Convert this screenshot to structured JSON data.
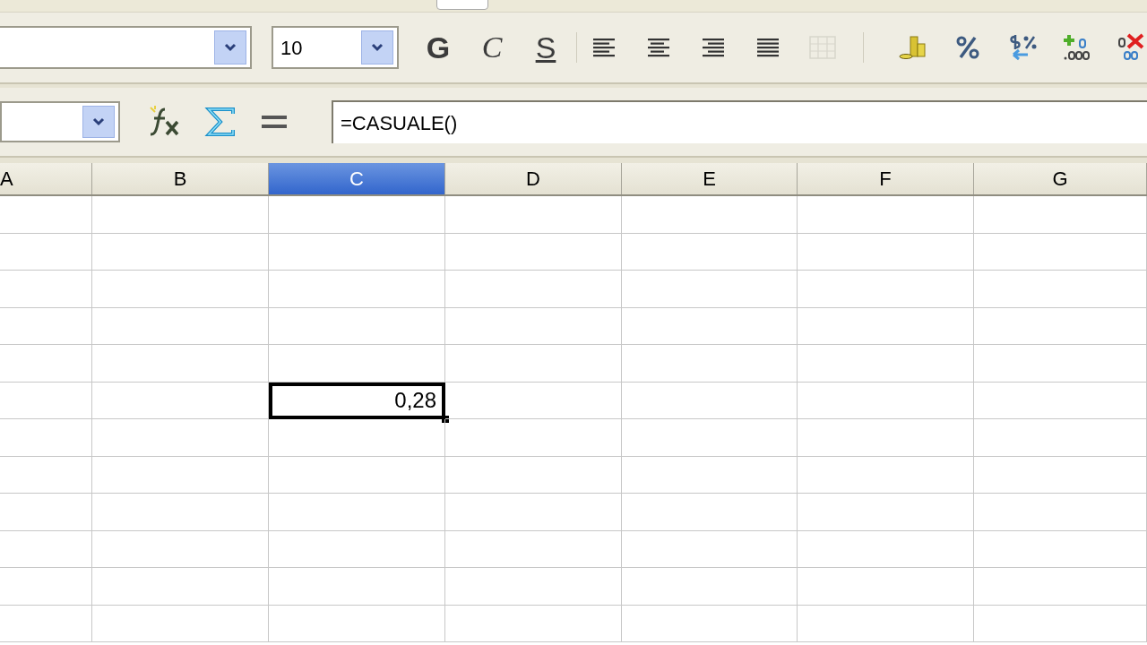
{
  "formatting_toolbar": {
    "font_size": {
      "value": "10"
    },
    "style_buttons": [
      {
        "label": "G",
        "kind": "bold"
      },
      {
        "label": "C",
        "kind": "italic"
      },
      {
        "label": "S",
        "kind": "underline"
      }
    ],
    "tools": [
      {
        "kind": "align-left",
        "disabled": false
      },
      {
        "kind": "align-center",
        "disabled": false
      },
      {
        "kind": "align-right",
        "disabled": false
      },
      {
        "kind": "justify",
        "disabled": false
      },
      {
        "kind": "merge",
        "disabled": true
      },
      {
        "kind": "currency",
        "disabled": false
      },
      {
        "kind": "percent",
        "disabled": false
      },
      {
        "kind": "standard",
        "disabled": false
      },
      {
        "kind": "add-decimal",
        "disabled": false
      },
      {
        "kind": "delete-decimal",
        "disabled": false
      }
    ]
  },
  "formula_bar": {
    "formula": {
      "value": "=CASUALE()"
    }
  },
  "columns": [
    {
      "label": "A",
      "selected": false
    },
    {
      "label": "B",
      "selected": false
    },
    {
      "label": "C",
      "selected": true
    },
    {
      "label": "D",
      "selected": false
    },
    {
      "label": "E",
      "selected": false
    },
    {
      "label": "F",
      "selected": false
    },
    {
      "label": "G",
      "selected": false
    }
  ],
  "rows": [
    {
      "cells": [
        {
          "selected": false
        },
        {
          "selected": false
        },
        {
          "selected": false
        },
        {
          "selected": false
        },
        {
          "selected": false
        },
        {
          "selected": false
        },
        {
          "selected": false
        }
      ]
    },
    {
      "cells": [
        {
          "selected": false
        },
        {
          "selected": false
        },
        {
          "selected": false
        },
        {
          "selected": false
        },
        {
          "selected": false
        },
        {
          "selected": false
        },
        {
          "selected": false
        }
      ]
    },
    {
      "cells": [
        {
          "selected": false
        },
        {
          "selected": false
        },
        {
          "selected": false
        },
        {
          "selected": false
        },
        {
          "selected": false
        },
        {
          "selected": false
        },
        {
          "selected": false
        }
      ]
    },
    {
      "cells": [
        {
          "selected": false
        },
        {
          "selected": false
        },
        {
          "selected": false
        },
        {
          "selected": false
        },
        {
          "selected": false
        },
        {
          "selected": false
        },
        {
          "selected": false
        }
      ]
    },
    {
      "cells": [
        {
          "selected": false
        },
        {
          "selected": false
        },
        {
          "selected": false
        },
        {
          "selected": false
        },
        {
          "selected": false
        },
        {
          "selected": false
        },
        {
          "selected": false
        }
      ]
    },
    {
      "cells": [
        {
          "selected": false
        },
        {
          "selected": false
        },
        {
          "selected": true,
          "value": "0,28"
        },
        {
          "selected": false
        },
        {
          "selected": false
        },
        {
          "selected": false
        },
        {
          "selected": false
        }
      ]
    },
    {
      "cells": [
        {
          "selected": false
        },
        {
          "selected": false
        },
        {
          "selected": false
        },
        {
          "selected": false
        },
        {
          "selected": false
        },
        {
          "selected": false
        },
        {
          "selected": false
        }
      ]
    },
    {
      "cells": [
        {
          "selected": false
        },
        {
          "selected": false
        },
        {
          "selected": false
        },
        {
          "selected": false
        },
        {
          "selected": false
        },
        {
          "selected": false
        },
        {
          "selected": false
        }
      ]
    },
    {
      "cells": [
        {
          "selected": false
        },
        {
          "selected": false
        },
        {
          "selected": false
        },
        {
          "selected": false
        },
        {
          "selected": false
        },
        {
          "selected": false
        },
        {
          "selected": false
        }
      ]
    },
    {
      "cells": [
        {
          "selected": false
        },
        {
          "selected": false
        },
        {
          "selected": false
        },
        {
          "selected": false
        },
        {
          "selected": false
        },
        {
          "selected": false
        },
        {
          "selected": false
        }
      ]
    },
    {
      "cells": [
        {
          "selected": false
        },
        {
          "selected": false
        },
        {
          "selected": false
        },
        {
          "selected": false
        },
        {
          "selected": false
        },
        {
          "selected": false
        },
        {
          "selected": false
        }
      ]
    },
    {
      "cells": [
        {
          "selected": false
        },
        {
          "selected": false
        },
        {
          "selected": false
        },
        {
          "selected": false
        },
        {
          "selected": false
        },
        {
          "selected": false
        },
        {
          "selected": false
        }
      ]
    }
  ]
}
